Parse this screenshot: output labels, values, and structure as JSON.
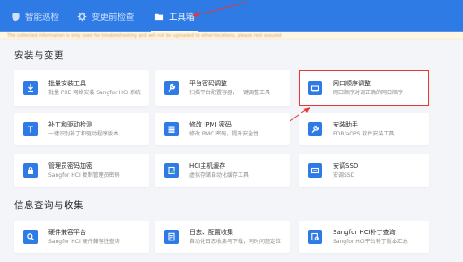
{
  "nav": {
    "tabs": [
      {
        "label": "智能巡检",
        "active": false
      },
      {
        "label": "变更前检查",
        "active": false
      },
      {
        "label": "工具箱",
        "active": true
      }
    ]
  },
  "notice": {
    "text": "The collected information is only used for troubleshooting and will not be uploaded to other locations, please rest assured"
  },
  "sections": {
    "install": {
      "title": "安装与变更"
    },
    "info": {
      "title": "信息查询与收集"
    }
  },
  "cards": [
    {
      "title": "批量安装工具",
      "desc": "批量 PXE 网络安装 Sangfor HCI 系统",
      "icon": "download-icon"
    },
    {
      "title": "平台密码调整",
      "desc": "扫描平台配置容器，一键调整工具",
      "icon": "wrench-icon"
    },
    {
      "title": "网口顺序调整",
      "desc": "网口顺序对调正确的网口顺序",
      "icon": "network-card-icon"
    },
    {
      "title": "补丁和驱动检测",
      "desc": "一键识别补丁和驱动程序版本",
      "icon": "patch-icon"
    },
    {
      "title": "修改 IPMI 密码",
      "desc": "修改 BMC 密码，提升安全性",
      "icon": "server-icon"
    },
    {
      "title": "安装助手",
      "desc": "EDR/aOPS 软件安装工具",
      "icon": "tool-icon"
    },
    {
      "title": "管理员密码加密",
      "desc": "Sangfor HCI 复制管理员密码",
      "icon": "lock-icon"
    },
    {
      "title": "HCI主机缓存",
      "desc": "虚拟存储自动化缓存工具",
      "icon": "hci-cache-icon"
    },
    {
      "title": "安调SSD",
      "desc": "安调SSD",
      "icon": "ssd-icon"
    },
    {
      "title": "硬件兼容平台",
      "desc": "Sangfor HCI 硬件兼容性查询",
      "icon": "search-icon"
    },
    {
      "title": "日志、配置收集",
      "desc": "自动化日志收集与下载，同时问题定位",
      "icon": "log-icon"
    },
    {
      "title": "Sangfor HCI补丁查询",
      "desc": "Sangfor HCI平台补丁版本汇总",
      "icon": "patch-query-icon"
    }
  ],
  "colors": {
    "nav_bg": "#2f7be6",
    "card_icon": "#2f7be6",
    "highlight": "#e53935",
    "page_bg": "#f3f5f8"
  }
}
